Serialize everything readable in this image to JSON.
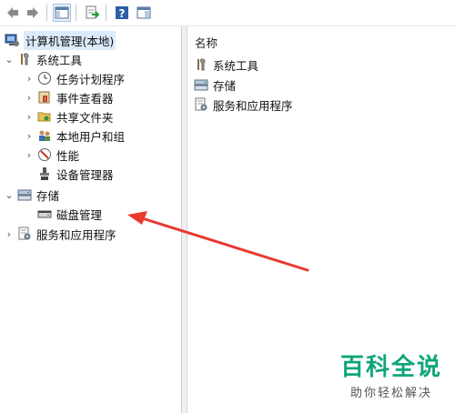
{
  "toolbar": {
    "buttons": [
      {
        "name": "back",
        "icon": "arrow-left-icon"
      },
      {
        "name": "forward",
        "icon": "arrow-right-icon"
      },
      {
        "name": "console-tree",
        "icon": "console-tree-icon"
      },
      {
        "name": "export-list",
        "icon": "export-icon"
      },
      {
        "name": "help",
        "icon": "help-icon"
      },
      {
        "name": "show-pane",
        "icon": "pane-icon"
      }
    ]
  },
  "tree": {
    "root": {
      "label": "计算机管理(本地)",
      "icon": "computer-management-icon"
    },
    "system_tools": {
      "label": "系统工具",
      "icon": "tools-icon",
      "expanded": true
    },
    "system_items": [
      {
        "label": "任务计划程序",
        "icon": "clock-icon"
      },
      {
        "label": "事件查看器",
        "icon": "event-viewer-icon"
      },
      {
        "label": "共享文件夹",
        "icon": "shared-folder-icon"
      },
      {
        "label": "本地用户和组",
        "icon": "users-icon"
      },
      {
        "label": "性能",
        "icon": "performance-icon"
      },
      {
        "label": "设备管理器",
        "icon": "device-manager-icon"
      }
    ],
    "storage": {
      "label": "存储",
      "icon": "storage-icon",
      "expanded": true
    },
    "disk_management": {
      "label": "磁盘管理",
      "icon": "disk-icon"
    },
    "services": {
      "label": "服务和应用程序",
      "icon": "services-icon"
    }
  },
  "list": {
    "column_header": "名称",
    "items": [
      {
        "label": "系统工具",
        "icon": "tools-icon"
      },
      {
        "label": "存储",
        "icon": "storage-icon"
      },
      {
        "label": "服务和应用程序",
        "icon": "services-icon"
      }
    ]
  },
  "annotation": {
    "color": "#e83a2f"
  },
  "watermark": {
    "title": "百科全说",
    "subtitle": "助你轻松解决",
    "color": "#0fa57a"
  }
}
